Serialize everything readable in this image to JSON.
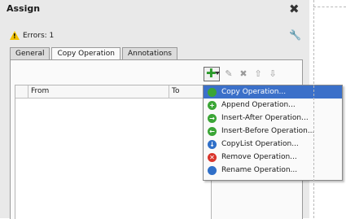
{
  "panel": {
    "title": "Assign",
    "errors": "Errors: 1"
  },
  "tabs": [
    {
      "label": "General",
      "active": false
    },
    {
      "label": "Copy Operation",
      "active": true
    },
    {
      "label": "Annotations",
      "active": false
    }
  ],
  "table": {
    "columns": [
      "From",
      "To"
    ]
  },
  "menu": {
    "items": [
      {
        "label": "Copy Operation...",
        "icon": "green-dot-icon",
        "color": "#3aa535",
        "selected": true
      },
      {
        "label": "Append Operation...",
        "icon": "append-icon",
        "color": "#3aa535"
      },
      {
        "label": "Insert-After Operation...",
        "icon": "insert-after-icon",
        "color": "#3aa535"
      },
      {
        "label": "Insert-Before Operation...",
        "icon": "insert-before-icon",
        "color": "#3aa535"
      },
      {
        "label": "CopyList Operation...",
        "icon": "copylist-icon",
        "color": "#2f6fc8"
      },
      {
        "label": "Remove Operation...",
        "icon": "remove-icon",
        "color": "#d9342b"
      },
      {
        "label": "Rename Operation...",
        "icon": "rename-icon",
        "color": "#2f6fc8"
      }
    ]
  },
  "colors": {
    "selection": "#3b70c9",
    "add_green": "#2a9a2a"
  }
}
